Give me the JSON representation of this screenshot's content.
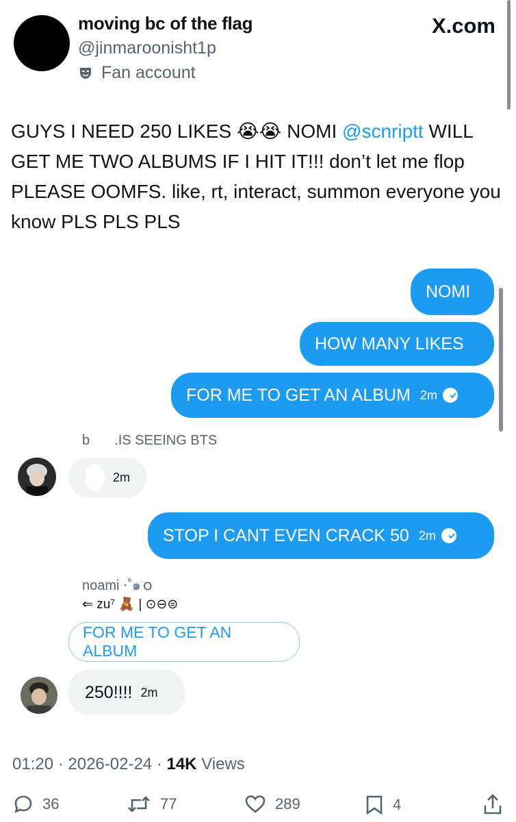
{
  "header": {
    "display_name": "moving bc of the flag",
    "handle": "@jinmaroonisht1p",
    "badge_label": "Fan account",
    "badge_icon": "theater-mask-icon",
    "watermark": "X.com"
  },
  "tweet": {
    "text_prefix": "GUYS I NEED 250 LIKES ",
    "emoji": "😭😭",
    "text_mid": " NOMI ",
    "mention": "@scnriptt",
    "text_suffix": " WILL GET ME TWO ALBUMS IF I HIT IT!!! don’t let me flop PLEASE OOMFS. like, rt, interact, summon everyone you know PLS PLS PLS"
  },
  "chat": {
    "outgoing_1": {
      "text": "NOMI"
    },
    "outgoing_2": {
      "text": "HOW MANY LIKES"
    },
    "outgoing_3": {
      "text": "FOR ME TO GET AN ALBUM",
      "time": "2m"
    },
    "incoming_1": {
      "sender": "b         .IS SEEING BTS",
      "time": "2m"
    },
    "outgoing_4": {
      "text": "STOP I CANT EVEN CRACK 50",
      "time": "2m"
    },
    "incoming_2": {
      "sender": "noami ⋅˚๑ｏ",
      "reply_to": "⇐ zu⁷ 🧸 | ⊙⊖⊜",
      "quoted": "FOR ME TO GET AN ALBUM",
      "text": "250!!!!",
      "time": "2m"
    }
  },
  "footer": {
    "time": "01:20",
    "date": "2026-02-24",
    "views_count": "14K",
    "views_label": "Views",
    "sep": " · "
  },
  "actions": {
    "replies": "36",
    "reposts": "77",
    "likes": "289",
    "bookmarks": "4"
  },
  "colors": {
    "accent": "#1d9bf0",
    "secondary_text": "#536471",
    "bubble_incoming": "#eff3f4"
  }
}
